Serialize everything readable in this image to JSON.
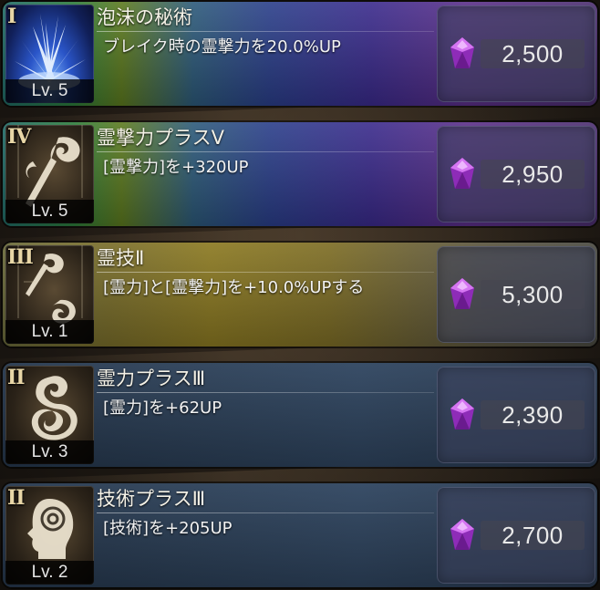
{
  "skills": [
    {
      "rank": "I",
      "level": "Lv. 5",
      "name": "泡沫の秘術",
      "description": "ブレイク時の霊撃力を20.0%UP",
      "cost": "2,500",
      "icon": "ice-burst-icon",
      "style": "rainbow"
    },
    {
      "rank": "IV",
      "level": "Lv. 5",
      "name": "霊撃力プラスV",
      "description": "[霊撃力]を+320UP",
      "cost": "2,950",
      "icon": "spirit-strike-icon",
      "style": "rainbow"
    },
    {
      "rank": "III",
      "level": "Lv. 1",
      "name": "霊技Ⅱ",
      "description": "[霊力]と[霊撃力]を+10.0%UPする",
      "cost": "5,300",
      "icon": "spirit-technique-icon",
      "style": "gold"
    },
    {
      "rank": "II",
      "level": "Lv. 3",
      "name": "霊力プラスⅢ",
      "description": "[霊力]を+62UP",
      "cost": "2,390",
      "icon": "spirit-power-icon",
      "style": "steel"
    },
    {
      "rank": "II",
      "level": "Lv. 2",
      "name": "技術プラスⅢ",
      "description": "[技術]を+205UP",
      "cost": "2,700",
      "icon": "technique-head-icon",
      "style": "steel"
    }
  ],
  "currency_icon": "purple-gem-icon",
  "colors": {
    "gem": "#b23ad6",
    "rank_numeral": "#e8d6a6"
  }
}
